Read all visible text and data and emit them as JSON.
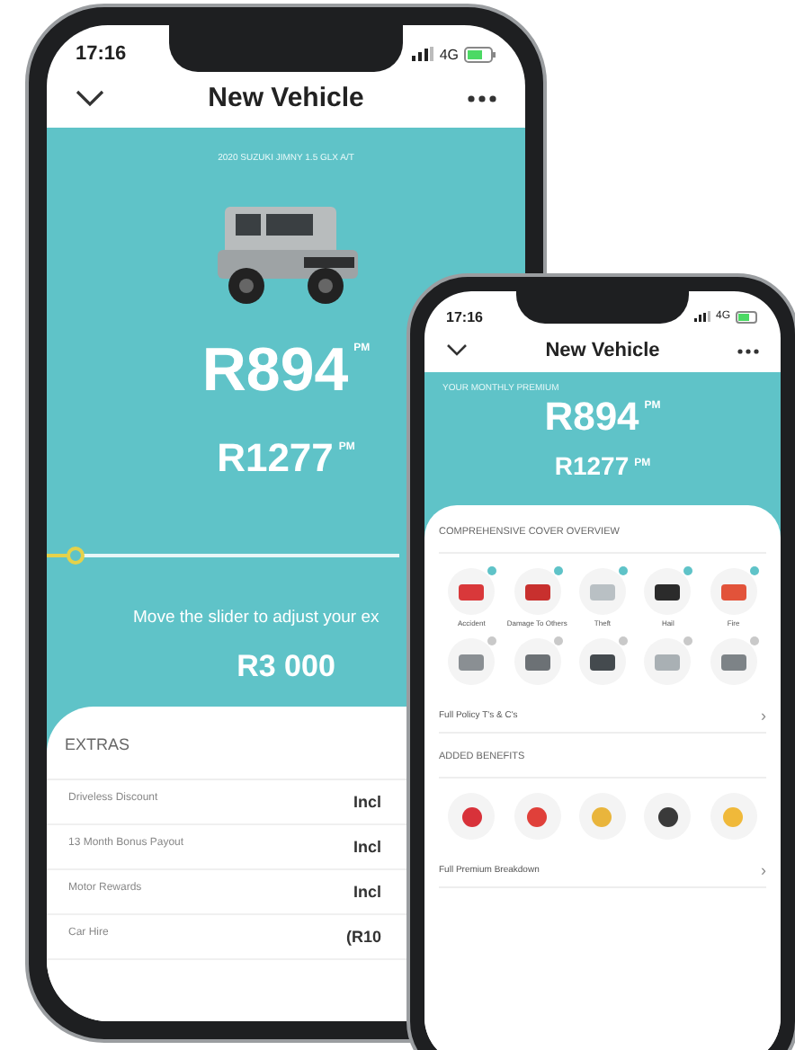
{
  "phone_main": {
    "status_bar": {
      "time": "17:16",
      "network": "4G"
    },
    "header": {
      "title": "New Vehicle"
    },
    "vehicle": "2020 SUZUKI JIMNY 1.5 GLX A/T",
    "premiums": [
      {
        "amount": "R894",
        "unit": "PM"
      },
      {
        "amount": "R1277",
        "unit": "PM"
      }
    ],
    "excess_slider": {
      "level": 0.08
    },
    "slider_hint": "Move the slider to adjust your ex",
    "excess": "R3 000",
    "extras": {
      "title": "EXTRAS",
      "rows": [
        {
          "label": "Driveless Discount",
          "value": "Incl"
        },
        {
          "label": "13 Month Bonus Payout",
          "value": "Incl"
        },
        {
          "label": "Motor Rewards",
          "value": "Incl"
        },
        {
          "label": "Car Hire",
          "value": "(R10"
        }
      ]
    }
  },
  "phone_front": {
    "status_bar": {
      "time": "17:16",
      "network": "4G"
    },
    "header": {
      "title": "New Vehicle"
    },
    "premium_label": "YOUR MONTHLY PREMIUM",
    "premiums": [
      {
        "amount": "R894",
        "unit": "PM"
      },
      {
        "amount": "R1277",
        "unit": "PM"
      }
    ],
    "cover": {
      "title": "COMPREHENSIVE COVER OVERVIEW",
      "items": [
        {
          "label": "Accident",
          "included": true,
          "color": "#d9383a"
        },
        {
          "label": "Damage To Others",
          "included": true,
          "color": "#c8302e"
        },
        {
          "label": "Theft",
          "included": true,
          "color": "#b9c0c4"
        },
        {
          "label": "Hail",
          "included": true,
          "color": "#2b2b2b"
        },
        {
          "label": "Fire",
          "included": true,
          "color": "#e2533a"
        },
        {
          "included": false,
          "color": "#8a8f93"
        },
        {
          "included": false,
          "color": "#6c7175"
        },
        {
          "included": false,
          "color": "#444a4e"
        },
        {
          "included": false,
          "color": "#a9b0b4"
        },
        {
          "included": false,
          "color": "#7d8387"
        }
      ],
      "link": "Full Policy T's & C's",
      "chevron": "›"
    },
    "benefits": {
      "title": "ADDED BENEFITS",
      "items": [
        {
          "color": "#d8323a"
        },
        {
          "color": "#e0403a"
        },
        {
          "color": "#e9b53c"
        },
        {
          "color": "#3a3a3a"
        },
        {
          "color": "#f0b93a"
        }
      ],
      "link": "Full Premium Breakdown",
      "chevron": "›"
    }
  }
}
